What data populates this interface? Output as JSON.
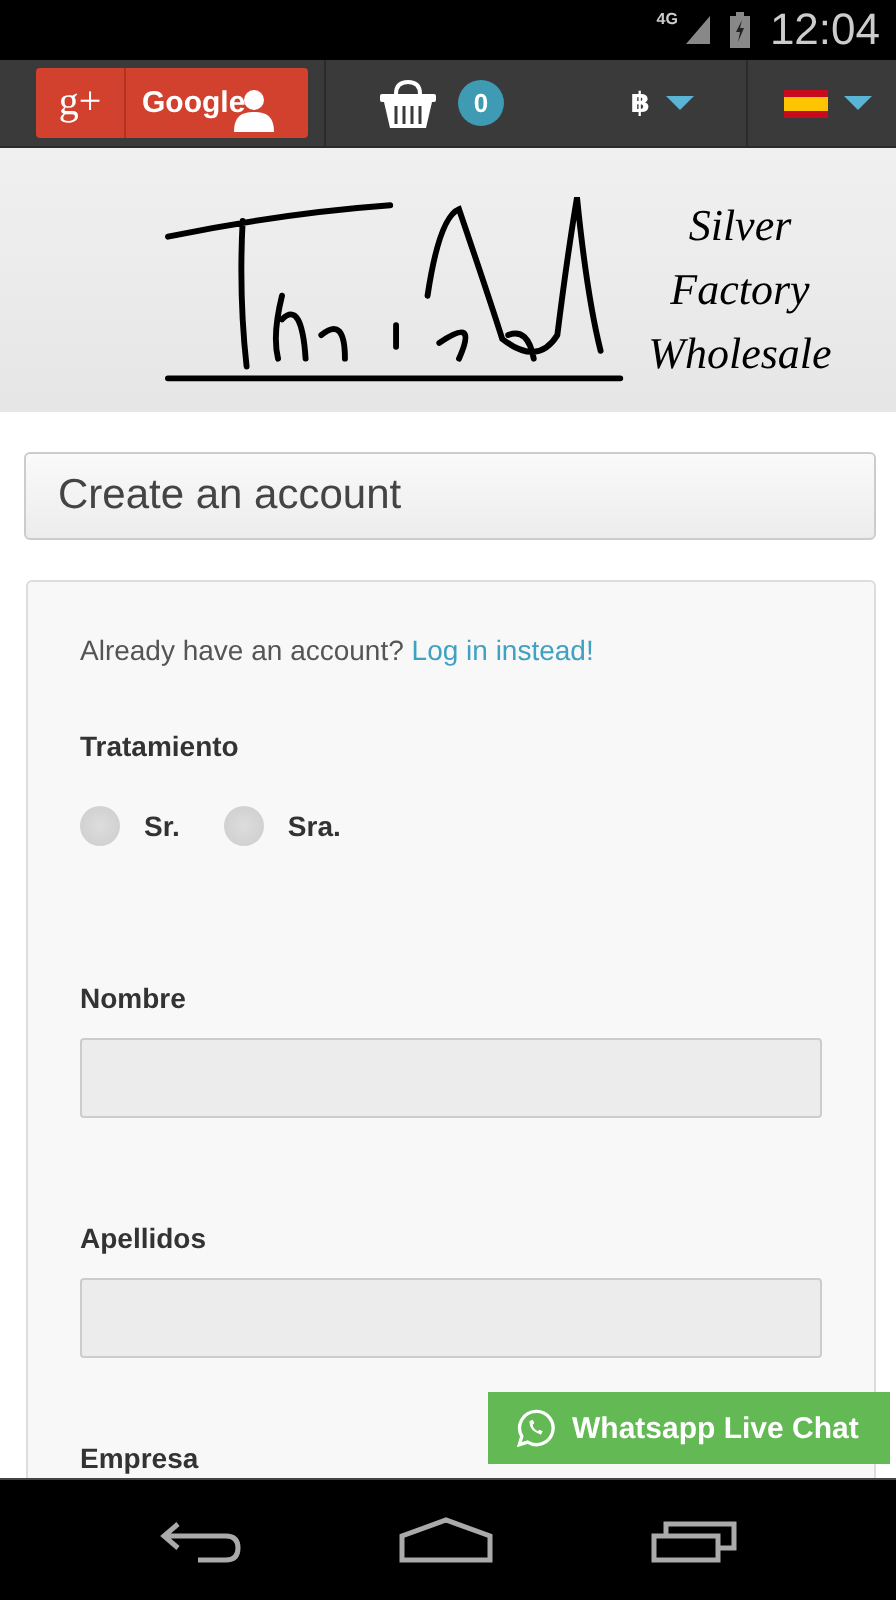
{
  "status_bar": {
    "network": "4G",
    "time": "12:04"
  },
  "top_bar": {
    "google_button": {
      "icon": "g+",
      "label": "Google"
    },
    "cart": {
      "count": "0"
    },
    "currency": {
      "symbol": "฿"
    }
  },
  "header": {
    "tagline": [
      "Silver",
      "Factory",
      "Wholesale"
    ]
  },
  "page_title": "Create an account",
  "form": {
    "login_prompt": "Already have an account?",
    "login_link": "Log in instead!",
    "title_field": {
      "label": "Tratamiento",
      "options": [
        {
          "label": "Sr.",
          "selected": false
        },
        {
          "label": "Sra.",
          "selected": false
        }
      ]
    },
    "fields": [
      {
        "label": "Nombre"
      },
      {
        "label": "Apellidos"
      }
    ],
    "cut_label": "Empresa"
  },
  "chat_button": {
    "label": "Whatsapp Live Chat"
  }
}
